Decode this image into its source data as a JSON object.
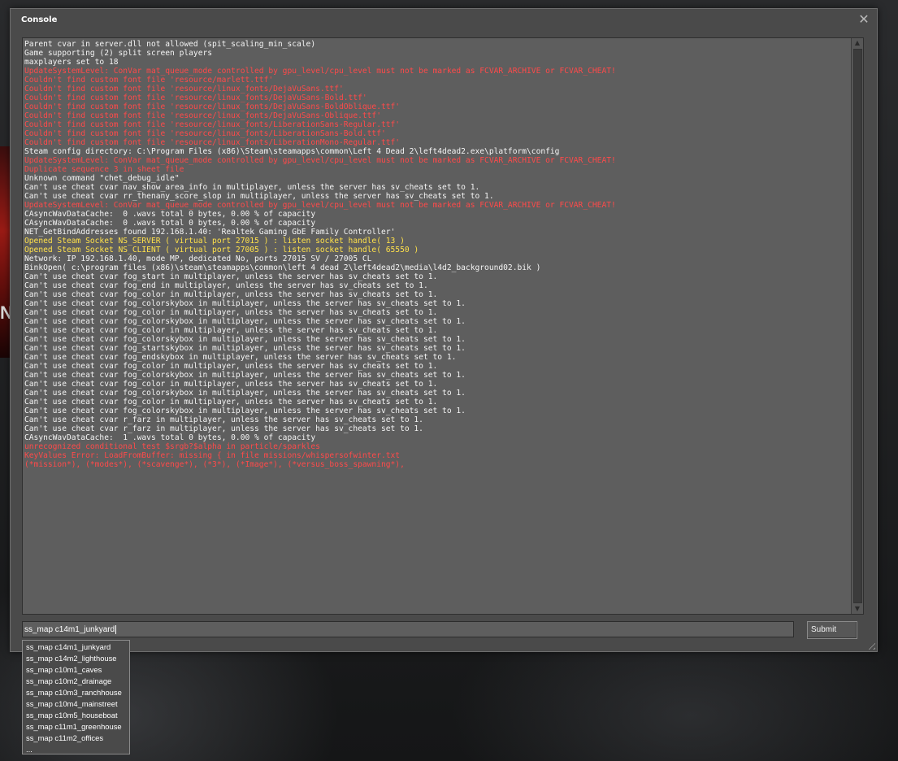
{
  "window": {
    "title": "Console",
    "close_glyph": "✕"
  },
  "colors": {
    "error": "#ff4a4a",
    "warn": "#ffe14a",
    "normal": "#f4f4f4",
    "panel": "#5e5e5e"
  },
  "output": {
    "lines": [
      {
        "text": "Parent cvar in server.dll not allowed (spit_scaling_min_scale)",
        "type": "normal"
      },
      {
        "text": "Game supporting (2) split screen players",
        "type": "normal"
      },
      {
        "text": "maxplayers set to 18",
        "type": "normal"
      },
      {
        "text": "UpdateSystemLevel: ConVar mat_queue_mode controlled by gpu_level/cpu_level must not be marked as FCVAR_ARCHIVE or FCVAR_CHEAT!",
        "type": "error"
      },
      {
        "text": "Couldn't find custom font file 'resource/marlett.ttf'",
        "type": "error"
      },
      {
        "text": "Couldn't find custom font file 'resource/linux_fonts/DejaVuSans.ttf'",
        "type": "error"
      },
      {
        "text": "Couldn't find custom font file 'resource/linux_fonts/DejaVuSans-Bold.ttf'",
        "type": "error"
      },
      {
        "text": "Couldn't find custom font file 'resource/linux_fonts/DejaVuSans-BoldOblique.ttf'",
        "type": "error"
      },
      {
        "text": "Couldn't find custom font file 'resource/linux_fonts/DejaVuSans-Oblique.ttf'",
        "type": "error"
      },
      {
        "text": "Couldn't find custom font file 'resource/linux_fonts/LiberationSans-Regular.ttf'",
        "type": "error"
      },
      {
        "text": "Couldn't find custom font file 'resource/linux_fonts/LiberationSans-Bold.ttf'",
        "type": "error"
      },
      {
        "text": "Couldn't find custom font file 'resource/linux_fonts/LiberationMono-Regular.ttf'",
        "type": "error"
      },
      {
        "text": "Steam config directory: C:\\Program Files (x86)\\Steam\\steamapps\\common\\Left 4 Dead 2\\left4dead2.exe\\platform\\config",
        "type": "normal"
      },
      {
        "text": "UpdateSystemLevel: ConVar mat_queue_mode controlled by gpu_level/cpu_level must not be marked as FCVAR_ARCHIVE or FCVAR_CHEAT!",
        "type": "error"
      },
      {
        "text": "Duplicate sequence 3 in sheet file",
        "type": "error"
      },
      {
        "text": "Unknown command \"chet_debug_idle\"",
        "type": "normal"
      },
      {
        "text": "Can't use cheat cvar nav_show_area_info in multiplayer, unless the server has sv_cheats set to 1.",
        "type": "normal"
      },
      {
        "text": "Can't use cheat cvar rr_thenany_score_slop in multiplayer, unless the server has sv_cheats set to 1.",
        "type": "normal"
      },
      {
        "text": "UpdateSystemLevel: ConVar mat_queue_mode controlled by gpu_level/cpu_level must not be marked as FCVAR_ARCHIVE or FCVAR_CHEAT!",
        "type": "error"
      },
      {
        "text": "CAsyncWavDataCache:  0 .wavs total 0 bytes, 0.00 % of capacity",
        "type": "normal"
      },
      {
        "text": "CAsyncWavDataCache:  0 .wavs total 0 bytes, 0.00 % of capacity",
        "type": "normal"
      },
      {
        "text": "NET_GetBindAddresses found 192.168.1.40: 'Realtek Gaming GbE Family Controller'",
        "type": "normal"
      },
      {
        "text": "Opened Steam Socket NS_SERVER ( virtual port 27015 ) : listen socket handle( 13 )",
        "type": "warn"
      },
      {
        "text": "Opened Steam Socket NS_CLIENT ( virtual port 27005 ) : listen socket handle( 65550 )",
        "type": "warn"
      },
      {
        "text": "Network: IP 192.168.1.40, mode MP, dedicated No, ports 27015 SV / 27005 CL",
        "type": "normal"
      },
      {
        "text": "BinkOpen( c:\\program files (x86)\\steam\\steamapps\\common\\left 4 dead 2\\left4dead2\\media\\l4d2_background02.bik )",
        "type": "normal"
      },
      {
        "text": "Can't use cheat cvar fog_start in multiplayer, unless the server has sv_cheats set to 1.",
        "type": "normal"
      },
      {
        "text": "Can't use cheat cvar fog_end in multiplayer, unless the server has sv_cheats set to 1.",
        "type": "normal"
      },
      {
        "text": "Can't use cheat cvar fog_color in multiplayer, unless the server has sv_cheats set to 1.",
        "type": "normal"
      },
      {
        "text": "Can't use cheat cvar fog_colorskybox in multiplayer, unless the server has sv_cheats set to 1.",
        "type": "normal"
      },
      {
        "text": "Can't use cheat cvar fog_color in multiplayer, unless the server has sv_cheats set to 1.",
        "type": "normal"
      },
      {
        "text": "Can't use cheat cvar fog_colorskybox in multiplayer, unless the server has sv_cheats set to 1.",
        "type": "normal"
      },
      {
        "text": "Can't use cheat cvar fog_color in multiplayer, unless the server has sv_cheats set to 1.",
        "type": "normal"
      },
      {
        "text": "Can't use cheat cvar fog_colorskybox in multiplayer, unless the server has sv_cheats set to 1.",
        "type": "normal"
      },
      {
        "text": "Can't use cheat cvar fog_startskybox in multiplayer, unless the server has sv_cheats set to 1.",
        "type": "normal"
      },
      {
        "text": "Can't use cheat cvar fog_endskybox in multiplayer, unless the server has sv_cheats set to 1.",
        "type": "normal"
      },
      {
        "text": "Can't use cheat cvar fog_color in multiplayer, unless the server has sv_cheats set to 1.",
        "type": "normal"
      },
      {
        "text": "Can't use cheat cvar fog_colorskybox in multiplayer, unless the server has sv_cheats set to 1.",
        "type": "normal"
      },
      {
        "text": "Can't use cheat cvar fog_color in multiplayer, unless the server has sv_cheats set to 1.",
        "type": "normal"
      },
      {
        "text": "Can't use cheat cvar fog_colorskybox in multiplayer, unless the server has sv_cheats set to 1.",
        "type": "normal"
      },
      {
        "text": "Can't use cheat cvar fog_color in multiplayer, unless the server has sv_cheats set to 1.",
        "type": "normal"
      },
      {
        "text": "Can't use cheat cvar fog_colorskybox in multiplayer, unless the server has sv_cheats set to 1.",
        "type": "normal"
      },
      {
        "text": "Can't use cheat cvar r_farz in multiplayer, unless the server has sv_cheats set to 1.",
        "type": "normal"
      },
      {
        "text": "Can't use cheat cvar r_farz in multiplayer, unless the server has sv_cheats set to 1.",
        "type": "normal"
      },
      {
        "text": "CAsyncWavDataCache:  1 .wavs total 0 bytes, 0.00 % of capacity",
        "type": "normal"
      },
      {
        "text": "unrecognized conditional test $srgb?$alpha in particle/sparkles",
        "type": "error"
      },
      {
        "text": "KeyValues Error: LoadFromBuffer: missing { in file missions/whispersofwinter.txt",
        "type": "error"
      },
      {
        "text": "(*mission*), (*modes*), (*scavenge*), (*3*), (*Image*), (*versus_boss_spawning*),",
        "type": "error"
      }
    ]
  },
  "command": {
    "value": "ss_map c14m1_junkyard",
    "submit_label": "Submit"
  },
  "autocomplete": [
    "ss_map c14m1_junkyard",
    "ss_map c14m2_lighthouse",
    "ss_map c10m1_caves",
    "ss_map c10m2_drainage",
    "ss_map c10m3_ranchhouse",
    "ss_map c10m4_mainstreet",
    "ss_map c10m5_houseboat",
    "ss_map c11m1_greenhouse",
    "ss_map c11m2_offices",
    "..."
  ],
  "background": {
    "glyph": "N"
  },
  "icons": {
    "close": "close-icon",
    "scroll_up": "chevron-up-icon",
    "scroll_down": "chevron-down-icon",
    "resize": "resize-grip-icon"
  }
}
